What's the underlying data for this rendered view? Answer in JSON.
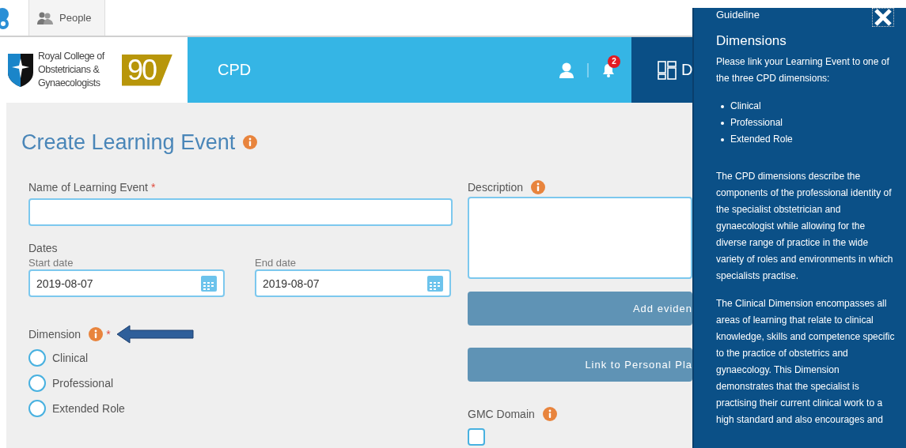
{
  "topbar": {
    "tabs": [
      {
        "label": "People"
      }
    ]
  },
  "header": {
    "logo_text": "Royal College of Obstetricians & Gynaecologists",
    "logo_badge": "90",
    "section": "CPD",
    "notifications": "2",
    "nav_item": "D"
  },
  "form": {
    "title": "Create Learning Event",
    "name_field": {
      "label": "Name of Learning Event",
      "required_mark": "*"
    },
    "dates": {
      "label": "Dates",
      "start": {
        "label": "Start date",
        "value": "2019-08-07"
      },
      "end": {
        "label": "End date",
        "value": "2019-08-07"
      }
    },
    "dimension": {
      "label": "Dimension",
      "required_mark": "*",
      "options": [
        {
          "label": "Clinical",
          "selected": false
        },
        {
          "label": "Professional",
          "selected": false
        },
        {
          "label": "Extended Role",
          "selected": false
        }
      ]
    },
    "description": {
      "label": "Description"
    },
    "buttons": [
      "Add eviden",
      "Link to Personal Pla"
    ],
    "gmc_domain": {
      "label": "GMC Domain",
      "options": [
        {
          "checked": false
        }
      ]
    }
  },
  "guide_panel": {
    "heading": "Guideline",
    "title": "Dimensions",
    "intro": "Please link your Learning Event to one of the three CPD dimensions:",
    "list": [
      "Clinical",
      "Professional",
      "Extended Role"
    ],
    "paragraphs": [
      "The CPD dimensions describe the components of the professional identity of the specialist obstetrician and gynaecologist while allowing for the diverse range of practice in the wide variety of roles and environments in which specialists practise.",
      "The Clinical Dimension encompasses all areas of learning that relate to clinical knowledge, skills and competence specific to the practice of obstetrics and gynaecology.  This Dimension demonstrates that the specialist is practising their current clinical work to a high standard and also encourages and"
    ]
  }
}
